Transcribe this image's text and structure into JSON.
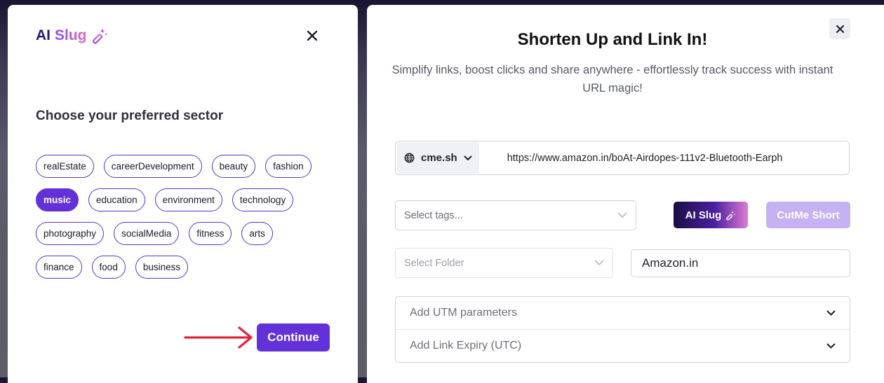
{
  "left_panel": {
    "brand_ai": "AI",
    "brand_slug": "Slug",
    "sector_title": "Choose your preferred sector",
    "sectors": [
      [
        "realEstate",
        "careerDevelopment",
        "beauty",
        "fashion"
      ],
      [
        "music",
        "education",
        "environment",
        "technology"
      ],
      [
        "photography",
        "socialMedia",
        "fitness",
        "arts"
      ],
      [
        "finance",
        "food",
        "business"
      ]
    ],
    "selected_sector": "music",
    "continue_label": "Continue"
  },
  "right_panel": {
    "headline": "Shorten Up and Link In!",
    "subline": "Simplify links, boost clicks and share anywhere - effortlessly track success with instant URL magic!",
    "domain": "cme.sh",
    "url_value": "https://www.amazon.in/boAt-Airdopes-111v2-Bluetooth-Earph",
    "tags_placeholder": "Select tags...",
    "ai_slug_label": "AI Slug",
    "cutme_label": "CutMe Short",
    "folder_placeholder": "Select Folder",
    "title_value": "Amazon.in",
    "utm_label": "Add UTM parameters",
    "expiry_label": "Add Link Expiry (UTC)"
  },
  "colors": {
    "primary": "#6232d8",
    "disabled_button": "#c5b2f2",
    "arrow": "#e0243a"
  }
}
